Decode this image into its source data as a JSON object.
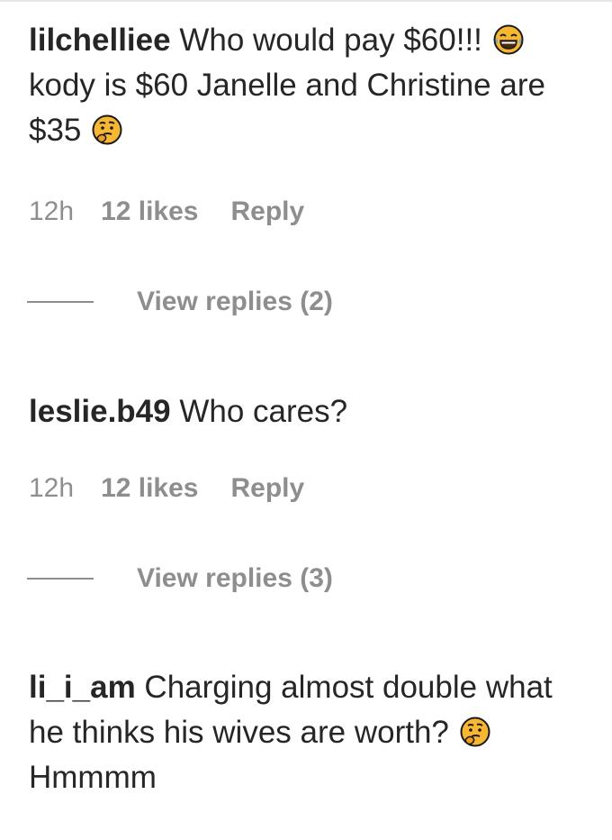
{
  "comments": [
    {
      "username": "lilchelliee",
      "text_1": " Who would pay $60!!! ",
      "emoji_1": "face-with-tears-of-joy-icon",
      "text_2": " kody is $60 Janelle and Christine are $35 ",
      "emoji_2": "thinking-face-icon",
      "time": "12h",
      "likes": "12 likes",
      "reply_label": "Reply",
      "view_replies": "View replies (2)"
    },
    {
      "username": "leslie.b49",
      "text_1": " Who cares?",
      "time": "12h",
      "likes": "12 likes",
      "reply_label": "Reply",
      "view_replies": "View replies (3)"
    },
    {
      "username": "li_i_am",
      "text_1": " Charging almost double what he thinks his wives are worth? ",
      "emoji_1": "thinking-face-icon",
      "text_2": " Hmmmm"
    }
  ],
  "colors": {
    "text": "#262626",
    "secondary": "#8e8e8e",
    "emoji_face": "#f7b733",
    "emoji_outline": "#1a1a1a"
  }
}
